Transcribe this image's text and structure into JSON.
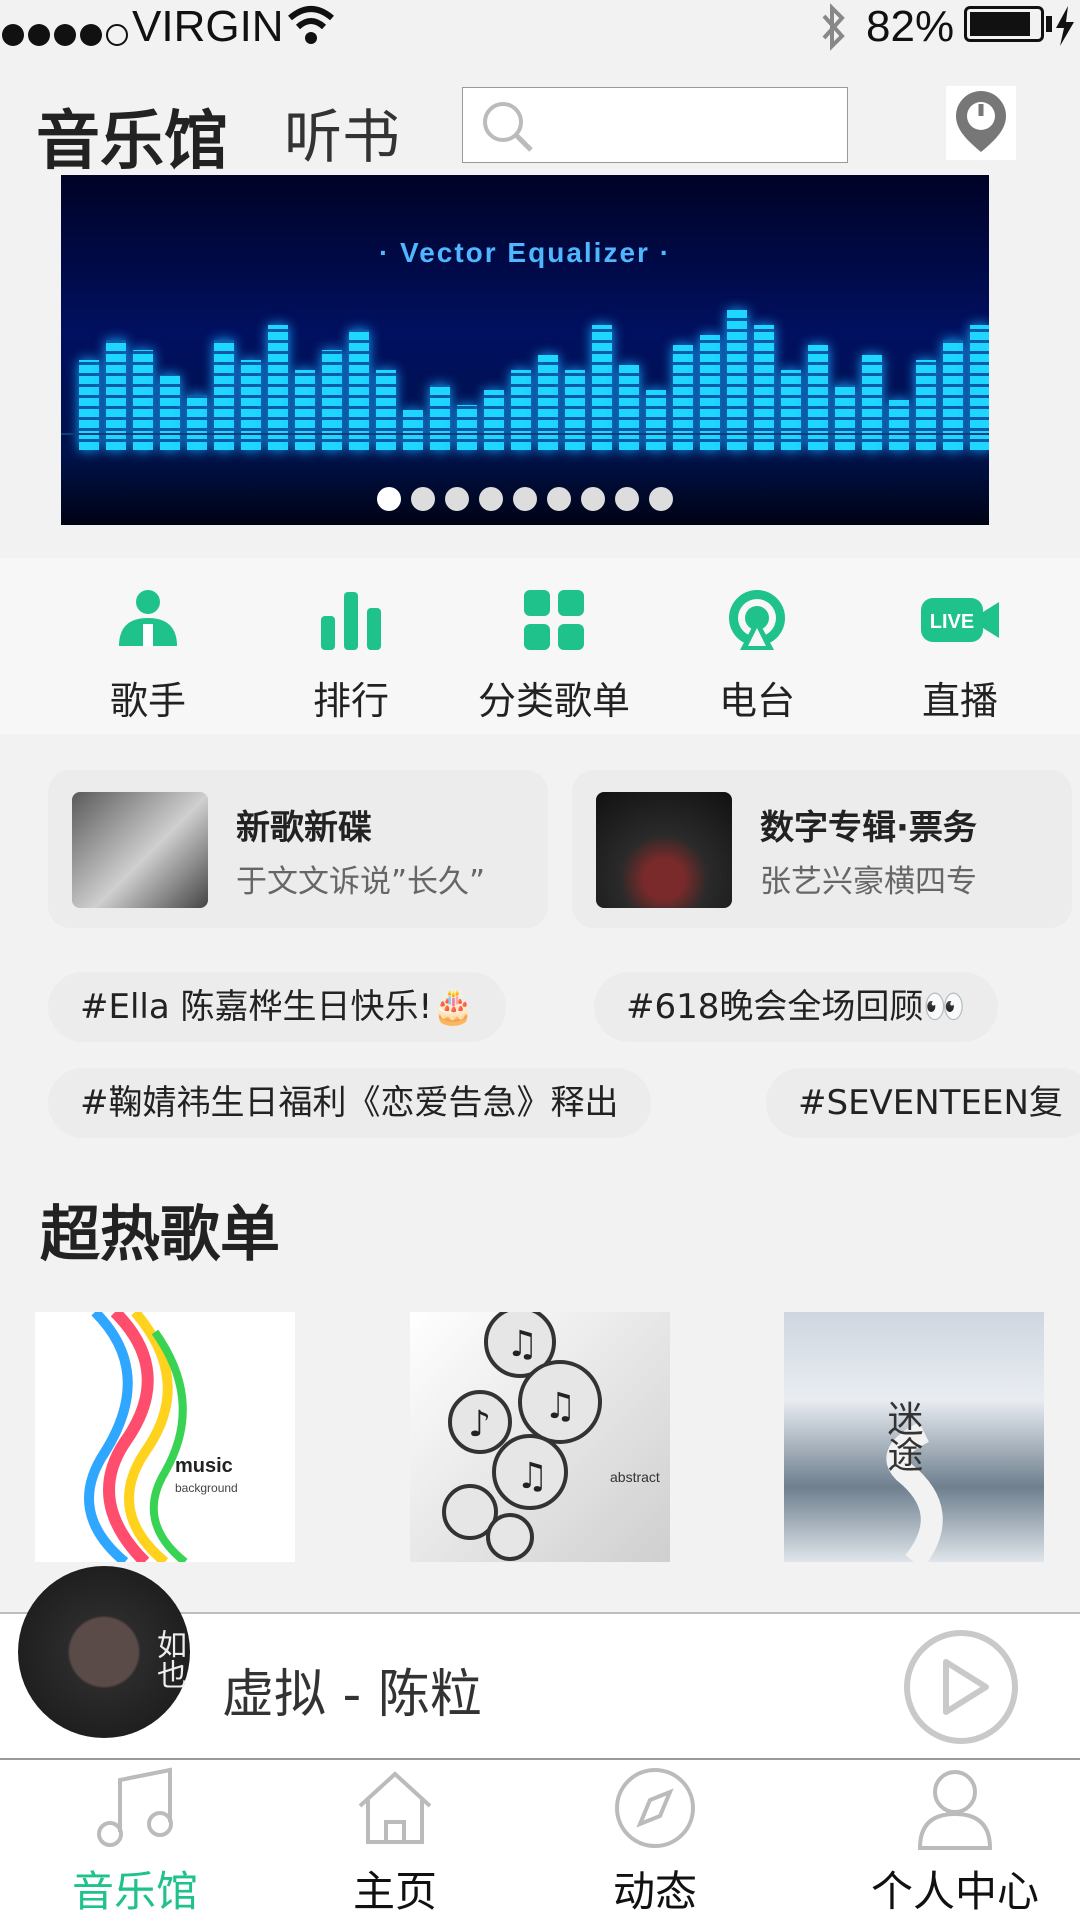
{
  "status_bar": {
    "carrier": "VIRGIN",
    "battery": "82%"
  },
  "header": {
    "tab_music_hall": "音乐馆",
    "tab_audiobook": "听书",
    "search_placeholder": ""
  },
  "banner": {
    "title": "· Vector Equalizer ·",
    "page_count": 9,
    "active_page": 1
  },
  "categories": [
    {
      "label": "歌手",
      "icon": "singer-icon"
    },
    {
      "label": "排行",
      "icon": "chart-bars-icon"
    },
    {
      "label": "分类歌单",
      "icon": "grid-icon"
    },
    {
      "label": "电台",
      "icon": "radio-icon"
    },
    {
      "label": "直播",
      "icon": "live-camera-icon",
      "badge": "LIVE"
    }
  ],
  "cards": [
    {
      "title": "新歌新碟",
      "subtitle": "于文文诉说”长久”"
    },
    {
      "title": "数字专辑·票务",
      "subtitle": "张艺兴豪横四专"
    }
  ],
  "tags": [
    "#Ella 陈嘉桦生日快乐!🎂",
    "#618晚会全场回顾👀",
    "#鞠婧祎生日福利《恋爱告急》释出",
    "#SEVENTEEN复"
  ],
  "section": {
    "title": "超热歌单"
  },
  "covers": [
    {
      "caption": "music",
      "sub": "background"
    },
    {
      "caption": "abstract",
      "sub": ""
    },
    {
      "caption": "迷途",
      "sub": ""
    }
  ],
  "player": {
    "track": "虚拟 - 陈粒",
    "disc_text": "如也"
  },
  "tabbar": [
    {
      "label": "音乐馆",
      "icon": "music-note-icon",
      "active": true
    },
    {
      "label": "主页",
      "icon": "home-icon",
      "active": false
    },
    {
      "label": "动态",
      "icon": "compass-icon",
      "active": false
    },
    {
      "label": "个人中心",
      "icon": "person-icon",
      "active": false
    }
  ],
  "colors": {
    "accent": "#1ec28a",
    "background": "#f2f2f2"
  }
}
